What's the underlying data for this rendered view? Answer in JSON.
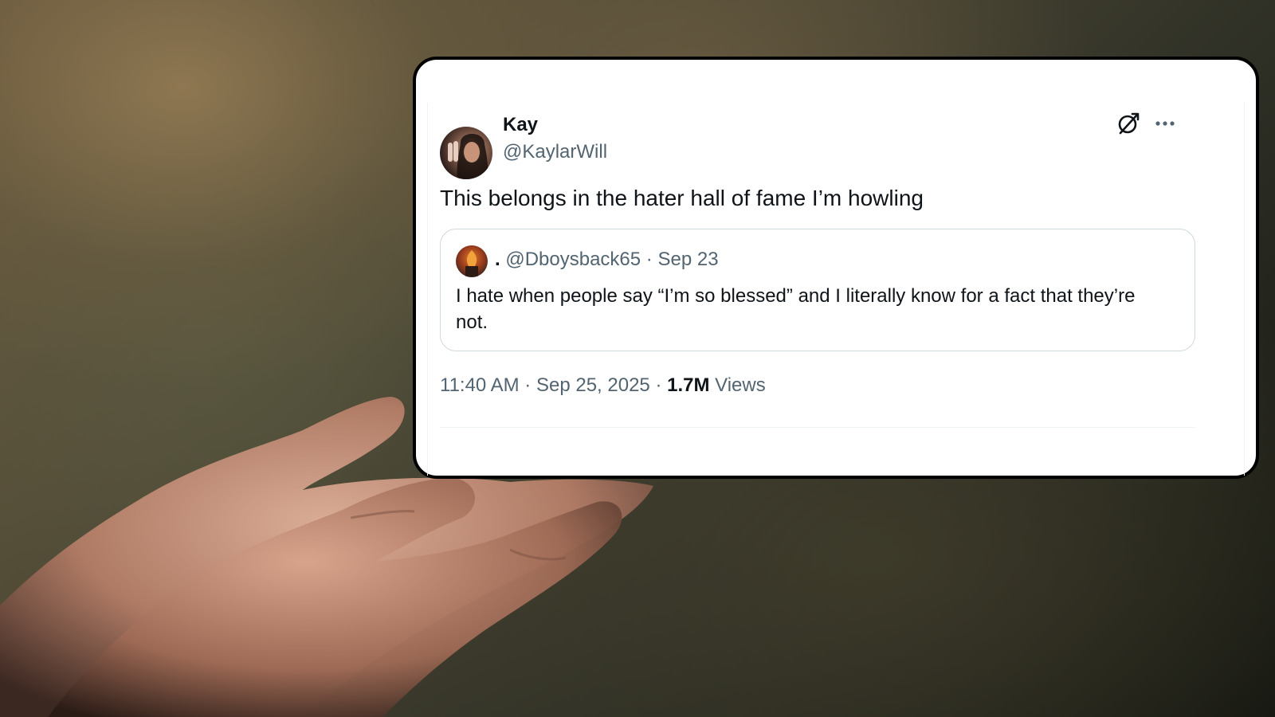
{
  "tweet": {
    "author": {
      "display_name": "Kay",
      "handle": "@KaylarWill"
    },
    "text": "This belongs in the hater hall of fame I’m howling",
    "quoted": {
      "display_name": ".",
      "handle": "@Dboysback65",
      "separator": "·",
      "date": "Sep 23",
      "text": "I hate when people say “I’m so blessed” and I literally know for a fact that they’re not."
    },
    "meta": {
      "time": "11:40 AM",
      "date": "Sep 25, 2025",
      "separator": "·",
      "views_count": "1.7M",
      "views_label": "Views"
    },
    "icons": {
      "grok": "grok-icon",
      "more": "more-icon"
    }
  },
  "colors": {
    "text_primary": "#0f1419",
    "text_secondary": "#536471",
    "card_border": "#000000",
    "quote_border": "#cfd9de"
  }
}
